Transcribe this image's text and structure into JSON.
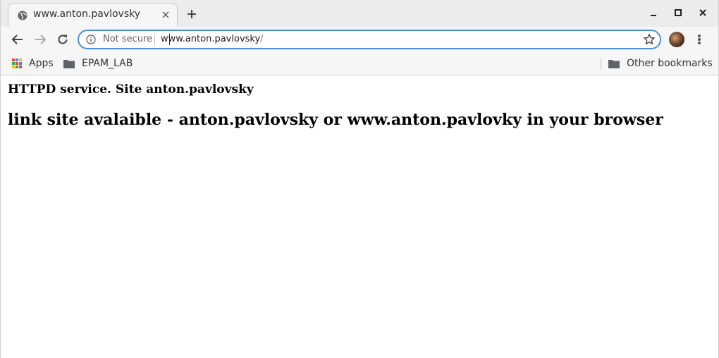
{
  "tab": {
    "title": "www.anton.pavlovsky",
    "favicon": "globe-icon"
  },
  "omnibox": {
    "security_label": "Not secure",
    "url_host": "www.anton.pavlovsky",
    "url_path": "/"
  },
  "bookmarks": {
    "apps_label": "Apps",
    "items": [
      {
        "label": "EPAM_LAB",
        "icon": "folder-icon"
      }
    ],
    "other_label": "Other bookmarks"
  },
  "page": {
    "heading_small": "HTTPD service. Site anton.pavlovsky",
    "heading_large": "link site avalaible - anton.pavlovsky or www.anton.pavlovky in your browser"
  },
  "colors": {
    "focus_ring": "#4a90d9",
    "tab_strip": "#ececec",
    "toolbar": "#f6f6f6"
  }
}
